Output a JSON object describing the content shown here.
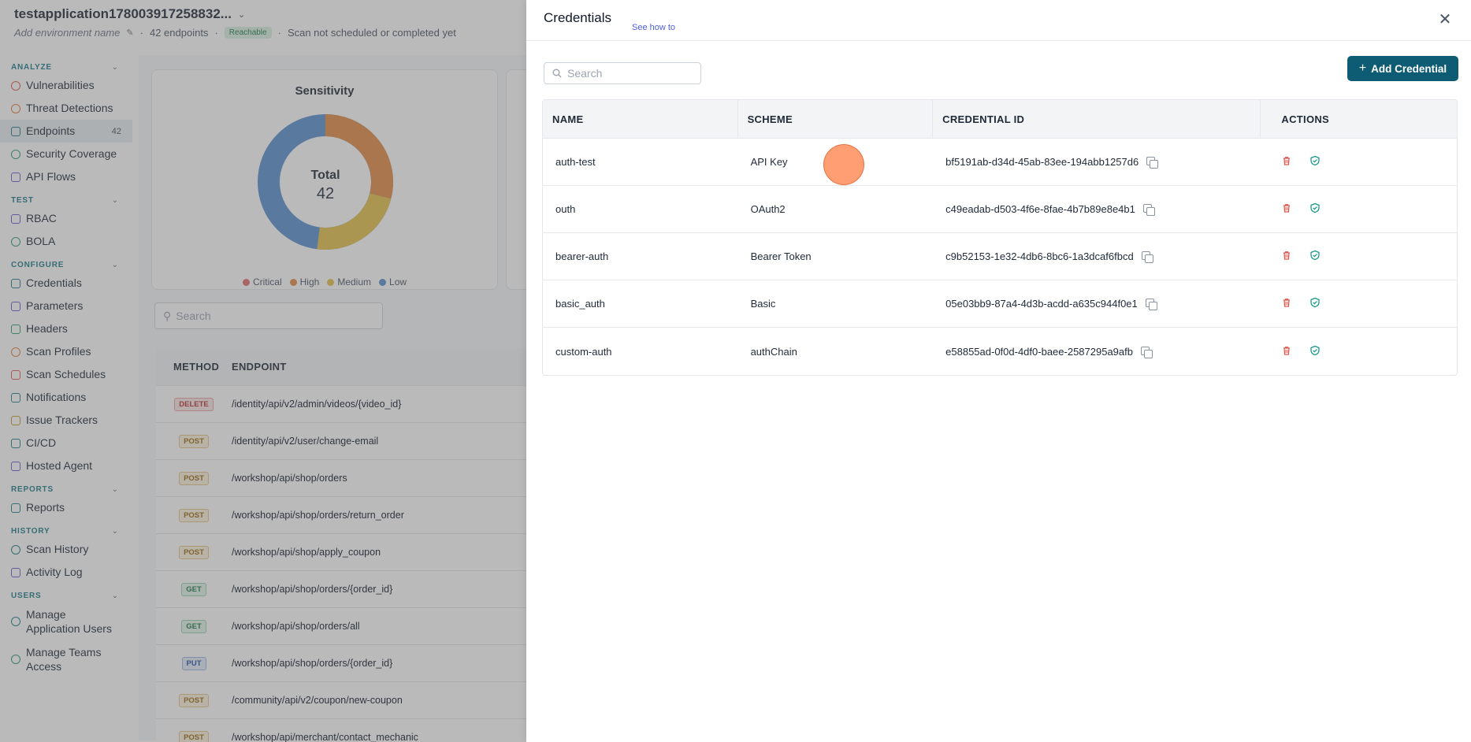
{
  "app": {
    "title": "testapplication178003917258832...",
    "env_placeholder": "Add environment name",
    "endpoint_count": "42 endpoints",
    "status_badge": "Reachable",
    "scan_status": "Scan not scheduled or completed yet"
  },
  "sidebar": {
    "sections": [
      {
        "title": "ANALYZE",
        "items": [
          {
            "label": "Vulnerabilities",
            "icon": "shield-alert-icon"
          },
          {
            "label": "Threat Detections",
            "icon": "radar-icon"
          },
          {
            "label": "Endpoints",
            "icon": "endpoints-icon",
            "count": "42",
            "active": true
          },
          {
            "label": "Security Coverage",
            "icon": "shield-check-icon"
          },
          {
            "label": "API Flows",
            "icon": "flow-icon"
          }
        ]
      },
      {
        "title": "TEST",
        "items": [
          {
            "label": "RBAC",
            "icon": "rbac-icon"
          },
          {
            "label": "BOLA",
            "icon": "bola-icon"
          }
        ]
      },
      {
        "title": "CONFIGURE",
        "items": [
          {
            "label": "Credentials",
            "icon": "key-icon"
          },
          {
            "label": "Parameters",
            "icon": "braces-icon"
          },
          {
            "label": "Headers",
            "icon": "headers-icon"
          },
          {
            "label": "Scan Profiles",
            "icon": "gauge-icon"
          },
          {
            "label": "Scan Schedules",
            "icon": "calendar-icon"
          },
          {
            "label": "Notifications",
            "icon": "bell-icon"
          },
          {
            "label": "Issue Trackers",
            "icon": "tracker-icon"
          },
          {
            "label": "CI/CD",
            "icon": "cicd-icon"
          },
          {
            "label": "Hosted Agent",
            "icon": "agent-icon"
          }
        ]
      },
      {
        "title": "REPORTS",
        "items": [
          {
            "label": "Reports",
            "icon": "report-icon"
          }
        ]
      },
      {
        "title": "HISTORY",
        "items": [
          {
            "label": "Scan History",
            "icon": "history-icon"
          },
          {
            "label": "Activity Log",
            "icon": "activity-icon"
          }
        ]
      },
      {
        "title": "USERS",
        "items": [
          {
            "label": "Manage Application Users",
            "icon": "users-icon"
          },
          {
            "label": "Manage Teams Access",
            "icon": "team-icon"
          }
        ]
      }
    ]
  },
  "sensitivity": {
    "title": "Sensitivity",
    "center_label": "Total",
    "center_value": "42",
    "legend": [
      {
        "label": "Critical",
        "color": "#e36b6b"
      },
      {
        "label": "High",
        "color": "#e38a45"
      },
      {
        "label": "Medium",
        "color": "#e3c04a"
      },
      {
        "label": "Low",
        "color": "#5b8fd1"
      }
    ]
  },
  "endpoints": {
    "search_placeholder": "Search",
    "headers": {
      "method": "METHOD",
      "endpoint": "ENDPOINT"
    },
    "rows": [
      {
        "method": "DELETE",
        "path": "/identity/api/v2/admin/videos/{video_id}"
      },
      {
        "method": "POST",
        "path": "/identity/api/v2/user/change-email"
      },
      {
        "method": "POST",
        "path": "/workshop/api/shop/orders"
      },
      {
        "method": "POST",
        "path": "/workshop/api/shop/orders/return_order"
      },
      {
        "method": "POST",
        "path": "/workshop/api/shop/apply_coupon"
      },
      {
        "method": "GET",
        "path": "/workshop/api/shop/orders/{order_id}"
      },
      {
        "method": "GET",
        "path": "/workshop/api/shop/orders/all"
      },
      {
        "method": "PUT",
        "path": "/workshop/api/shop/orders/{order_id}"
      },
      {
        "method": "POST",
        "path": "/community/api/v2/coupon/new-coupon"
      },
      {
        "method": "POST",
        "path": "/workshop/api/merchant/contact_mechanic"
      }
    ]
  },
  "credentials": {
    "title": "Credentials",
    "see_how": "See how to",
    "search_placeholder": "Search",
    "add_button": "Add Credential",
    "headers": {
      "name": "NAME",
      "scheme": "SCHEME",
      "credential_id": "CREDENTIAL ID",
      "actions": "ACTIONS"
    },
    "rows": [
      {
        "name": "auth-test",
        "scheme": "API Key",
        "id": "bf5191ab-d34d-45ab-83ee-194abb1257d6"
      },
      {
        "name": "outh",
        "scheme": "OAuth2",
        "id": "c49eadab-d503-4f6e-8fae-4b7b89e8e4b1"
      },
      {
        "name": "bearer-auth",
        "scheme": "Bearer Token",
        "id": "c9b52153-1e32-4db6-8bc6-1a3dcaf6fbcd"
      },
      {
        "name": "basic_auth",
        "scheme": "Basic",
        "id": "05e03bb9-87a4-4d3b-acdd-a635c944f0e1"
      },
      {
        "name": "custom-auth",
        "scheme": "authChain",
        "id": "e58855ad-0f0d-4df0-baee-2587295a9afb"
      }
    ]
  },
  "colors": {
    "accent": "#0e5c73",
    "section_heading": "#1c7a8a",
    "delete_red": "#e05a4f",
    "verify_teal": "#1a9a8a"
  }
}
